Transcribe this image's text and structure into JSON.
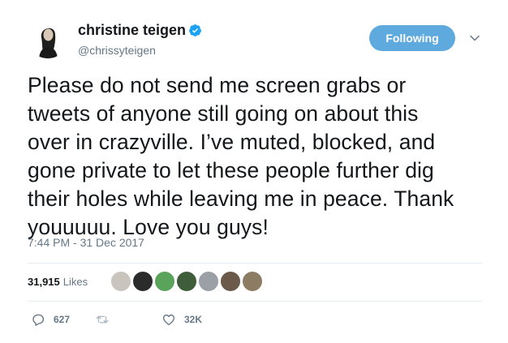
{
  "user": {
    "display_name": "christine teigen",
    "handle": "@chrissyteigen",
    "verified_icon": "verified-badge-icon"
  },
  "follow_button": {
    "label": "Following",
    "color": "#5ea9dd"
  },
  "tweet": {
    "text_lines": [
      "Please do not send me screen grabs or",
      "tweets of anyone still going on about this",
      "over in crazyville. I’ve muted, blocked, and",
      "gone private to let these people further dig",
      "their holes while leaving me in peace. Thank",
      "youuuuu. Love you guys!"
    ],
    "timestamp": "7:44 PM - 31 Dec 2017"
  },
  "stats": {
    "likes_count": "31,915",
    "likes_label": "Likes",
    "liker_avatars": [
      "#c9c4bd",
      "#2b2b2b",
      "#5aa35a",
      "#3f5c3b",
      "#9aa0a6",
      "#6b5a4a",
      "#8c7c64"
    ]
  },
  "actions": {
    "reply_count": "627",
    "retweet_count": "",
    "like_count": "32K"
  },
  "colors": {
    "accent": "#1da1f2",
    "muted": "#657786",
    "text": "#14171a"
  }
}
